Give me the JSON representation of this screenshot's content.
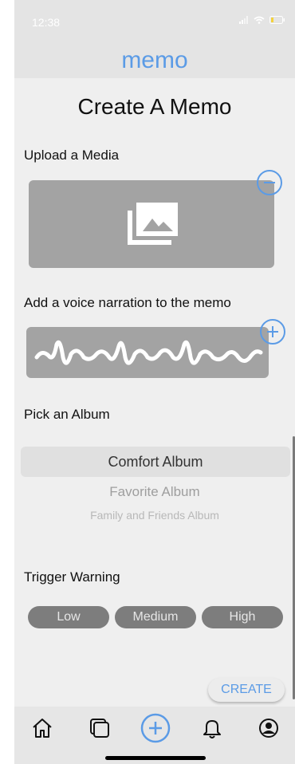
{
  "status_bar": {
    "time": "12:38",
    "icons": [
      "signal-icon",
      "wifi-icon",
      "battery-icon"
    ]
  },
  "header": {
    "app_title": "memo"
  },
  "page": {
    "title": "Create A Memo"
  },
  "media_section": {
    "label": "Upload a Media",
    "icon": "photo-library-icon",
    "remove_icon": "minus-circle-icon"
  },
  "voice_section": {
    "label": "Add a voice narration to the memo",
    "icon": "waveform-icon",
    "add_icon": "plus-circle-icon"
  },
  "album_section": {
    "label": "Pick an Album",
    "options": [
      "Comfort Album",
      "Favorite Album",
      "Family and Friends Album"
    ],
    "selected": "Comfort Album"
  },
  "trigger_section": {
    "label": "Trigger Warning",
    "options": [
      "Low",
      "Medium",
      "High"
    ]
  },
  "create_button": {
    "label": "CREATE"
  },
  "tab_bar": {
    "items": [
      "home-icon",
      "memos-icon",
      "create-icon",
      "notifications-icon",
      "profile-icon"
    ],
    "active": "create-icon"
  },
  "colors": {
    "accent": "#5b9be6",
    "panel": "#a3a3a3",
    "pill": "#7d7d7d",
    "background": "#efefef"
  }
}
